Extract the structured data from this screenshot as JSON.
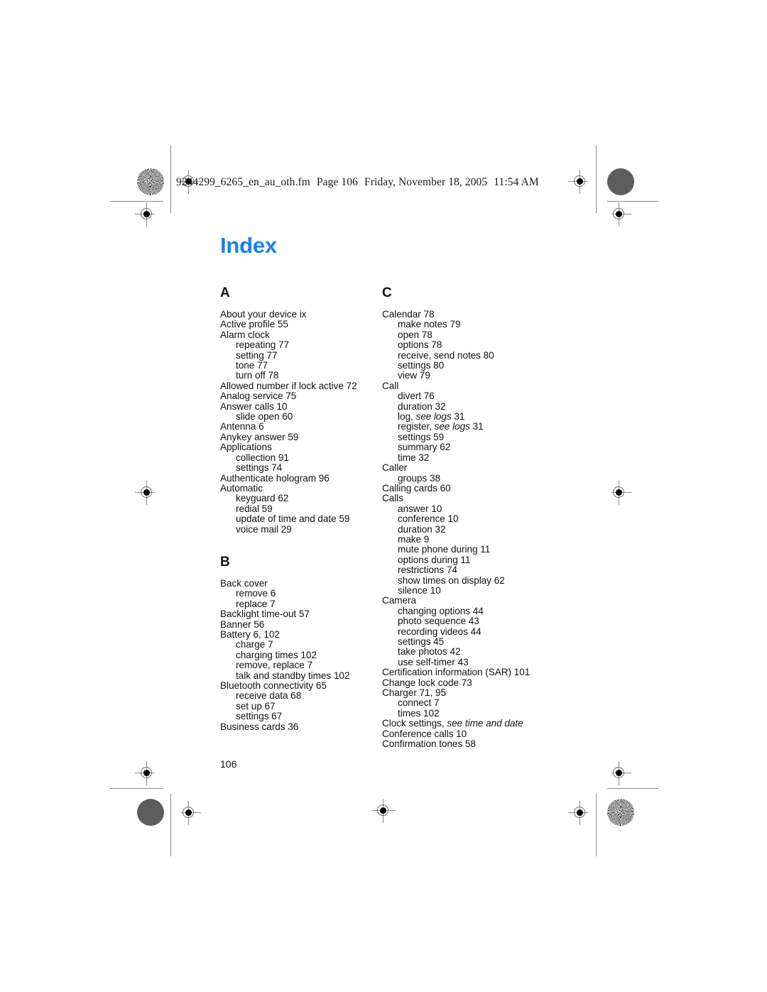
{
  "header": {
    "filename": "9244299_6265_en_au_oth.fm",
    "page_label": "Page 106",
    "date": "Friday, November 18, 2005",
    "time": "11:54 AM"
  },
  "title": "Index",
  "page_number": "106",
  "colors": {
    "title_blue": "#1a7ff2",
    "text_black": "#111111",
    "mark_gray": "#8c8c8c"
  },
  "columns": [
    {
      "sections": [
        {
          "letter": "A",
          "entries": [
            {
              "text": "About your device ix",
              "level": 0
            },
            {
              "text": "Active profile 55",
              "level": 0
            },
            {
              "text": "Alarm clock",
              "level": 0
            },
            {
              "text": "repeating 77",
              "level": 1
            },
            {
              "text": "setting 77",
              "level": 1
            },
            {
              "text": "tone 77",
              "level": 1
            },
            {
              "text": "turn off 78",
              "level": 1
            },
            {
              "text": "Allowed number if lock active 72",
              "level": 0
            },
            {
              "text": "Analog service 75",
              "level": 0
            },
            {
              "text": "Answer calls 10",
              "level": 0
            },
            {
              "text": "slide open 60",
              "level": 1
            },
            {
              "text": "Antenna 6",
              "level": 0
            },
            {
              "text": "Anykey answer 59",
              "level": 0
            },
            {
              "text": "Applications",
              "level": 0
            },
            {
              "text": "collection 91",
              "level": 1
            },
            {
              "text": "settings 74",
              "level": 1
            },
            {
              "text": "Authenticate hologram 96",
              "level": 0
            },
            {
              "text": "Automatic",
              "level": 0
            },
            {
              "text": "keyguard 62",
              "level": 1
            },
            {
              "text": "redial 59",
              "level": 1
            },
            {
              "text": "update of time and date 59",
              "level": 1
            },
            {
              "text": "voice mail 29",
              "level": 1
            }
          ]
        },
        {
          "letter": "B",
          "entries": [
            {
              "text": "Back cover",
              "level": 0
            },
            {
              "text": "remove 6",
              "level": 1
            },
            {
              "text": "replace 7",
              "level": 1
            },
            {
              "text": "Backlight time-out 57",
              "level": 0
            },
            {
              "text": "Banner 56",
              "level": 0
            },
            {
              "text": "Battery 6, 102",
              "level": 0
            },
            {
              "text": "charge 7",
              "level": 1
            },
            {
              "text": "charging times 102",
              "level": 1
            },
            {
              "text": "remove, replace 7",
              "level": 1
            },
            {
              "text": "talk and standby times 102",
              "level": 1
            },
            {
              "text": "Bluetooth connectivity 65",
              "level": 0
            },
            {
              "text": "receive data 68",
              "level": 1
            },
            {
              "text": "set up 67",
              "level": 1
            },
            {
              "text": "settings 67",
              "level": 1
            },
            {
              "text": "Business cards 36",
              "level": 0
            }
          ]
        }
      ]
    },
    {
      "sections": [
        {
          "letter": "C",
          "entries": [
            {
              "text": "Calendar 78",
              "level": 0
            },
            {
              "text": "make notes 79",
              "level": 1
            },
            {
              "text": "open 78",
              "level": 1
            },
            {
              "text": "options 78",
              "level": 1
            },
            {
              "text": "receive, send notes 80",
              "level": 1
            },
            {
              "text": "settings 80",
              "level": 1
            },
            {
              "text": "view 79",
              "level": 1
            },
            {
              "text": "Call",
              "level": 0
            },
            {
              "text": "divert 76",
              "level": 1
            },
            {
              "text": "duration 32",
              "level": 1
            },
            {
              "text": "log, ",
              "italic": "see logs",
              "tail": " 31",
              "level": 1
            },
            {
              "text": "register, ",
              "italic": "see logs",
              "tail": " 31",
              "level": 1
            },
            {
              "text": "settings 59",
              "level": 1
            },
            {
              "text": "summary 62",
              "level": 1
            },
            {
              "text": "time 32",
              "level": 1
            },
            {
              "text": "Caller",
              "level": 0
            },
            {
              "text": "groups 38",
              "level": 1
            },
            {
              "text": "Calling cards 60",
              "level": 0
            },
            {
              "text": "Calls",
              "level": 0
            },
            {
              "text": "answer 10",
              "level": 1
            },
            {
              "text": "conference 10",
              "level": 1
            },
            {
              "text": "duration 32",
              "level": 1
            },
            {
              "text": "make 9",
              "level": 1
            },
            {
              "text": "mute phone during 11",
              "level": 1
            },
            {
              "text": "options during 11",
              "level": 1
            },
            {
              "text": "restrictions 74",
              "level": 1
            },
            {
              "text": "show times on display 62",
              "level": 1
            },
            {
              "text": "silence 10",
              "level": 1
            },
            {
              "text": "Camera",
              "level": 0
            },
            {
              "text": "changing options 44",
              "level": 1
            },
            {
              "text": "photo sequence 43",
              "level": 1
            },
            {
              "text": "recording videos 44",
              "level": 1
            },
            {
              "text": "settings 45",
              "level": 1
            },
            {
              "text": "take photos 42",
              "level": 1
            },
            {
              "text": "use self-timer 43",
              "level": 1
            },
            {
              "text": "Certification information (SAR) 101",
              "level": 0
            },
            {
              "text": "Change lock code 73",
              "level": 0
            },
            {
              "text": "Charger 71, 95",
              "level": 0
            },
            {
              "text": "connect 7",
              "level": 1
            },
            {
              "text": "times 102",
              "level": 1
            },
            {
              "text": "Clock settings, ",
              "italic": "see time and date",
              "tail": "",
              "level": 0
            },
            {
              "text": "Conference calls 10",
              "level": 0
            },
            {
              "text": "Confirmation tones 58",
              "level": 0
            }
          ]
        }
      ]
    }
  ]
}
